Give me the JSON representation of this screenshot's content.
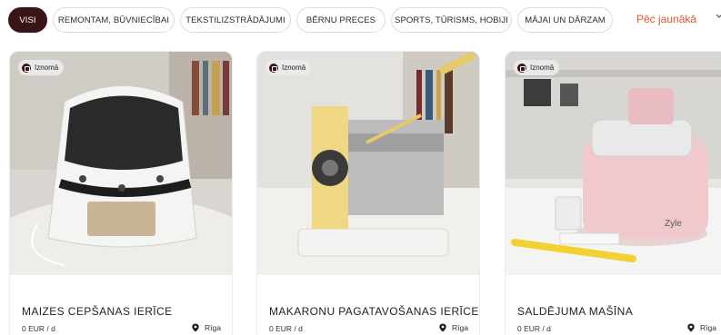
{
  "filters": {
    "items": [
      {
        "label": "VISI",
        "active": true
      },
      {
        "label": "REMONTAM, BŪVNIECĪBAI",
        "active": false
      },
      {
        "label": "TEKSTILIZSTRĀDĀJUMI",
        "active": false
      },
      {
        "label": "BĒRNU PRECES",
        "active": false
      },
      {
        "label": "SPORTS, TŪRISMS, HOBIJI",
        "active": false
      },
      {
        "label": "MĀJAI UN DĀRZAM",
        "active": false
      }
    ]
  },
  "sort": {
    "label": "Pēc jaunākā",
    "icon": "chevron-down-icon"
  },
  "colors": {
    "accent": "#e0582c",
    "active_chip": "#3a1418"
  },
  "cards": [
    {
      "badge": "Iznomā",
      "title": "MAIZES CEPŠANAS IERĪCE",
      "price": "0 EUR / d",
      "location": "Rīga",
      "image": "bread-maker"
    },
    {
      "badge": "Iznomā",
      "title": "MAKARONU PAGATAVOŠANAS IERĪCE",
      "price": "0 EUR / d",
      "location": "Rīga",
      "image": "pasta-machine"
    },
    {
      "badge": "Iznomā",
      "title": "SALDĒJUMA MAŠĪNA",
      "price": "0 EUR / d",
      "location": "Rīga",
      "image": "ice-cream-machine"
    }
  ]
}
